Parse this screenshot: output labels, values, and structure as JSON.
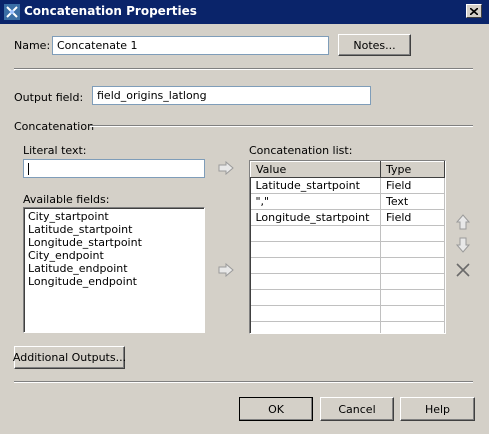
{
  "window": {
    "title": "Concatenation Properties"
  },
  "name": {
    "label": "Name:",
    "value": "Concatenate 1"
  },
  "notes_button": "Notes...",
  "output_field": {
    "label": "Output field:",
    "value": "field_origins_latlong"
  },
  "concatenation": {
    "group_label": "Concatenation",
    "literal_text_label": "Literal text:",
    "literal_text_value": "",
    "available_fields_label": "Available fields:",
    "available_fields": [
      "City_startpoint",
      "Latitude_startpoint",
      "Longitude_startpoint",
      "City_endpoint",
      "Latitude_endpoint",
      "Longitude_endpoint"
    ],
    "list_label": "Concatenation list:",
    "columns": [
      "Value",
      "Type"
    ],
    "rows": [
      {
        "value": "Latitude_startpoint",
        "type": "Field"
      },
      {
        "value": "\",\"",
        "type": "Text"
      },
      {
        "value": "Longitude_startpoint",
        "type": "Field"
      },
      {
        "value": "",
        "type": ""
      },
      {
        "value": "",
        "type": ""
      },
      {
        "value": "",
        "type": ""
      },
      {
        "value": "",
        "type": ""
      },
      {
        "value": "",
        "type": ""
      },
      {
        "value": "",
        "type": ""
      },
      {
        "value": "",
        "type": ""
      }
    ]
  },
  "additional_outputs_button": "Additional Outputs...",
  "footer": {
    "ok": "OK",
    "cancel": "Cancel",
    "help": "Help"
  },
  "colors": {
    "titlebar": "#0a246a",
    "dialog": "#d4d0c8",
    "field_border": "#7f9db9"
  },
  "icons": [
    "app-icon",
    "close-icon",
    "arrow-right-icon",
    "arrow-up-icon",
    "arrow-down-icon",
    "delete-icon"
  ]
}
